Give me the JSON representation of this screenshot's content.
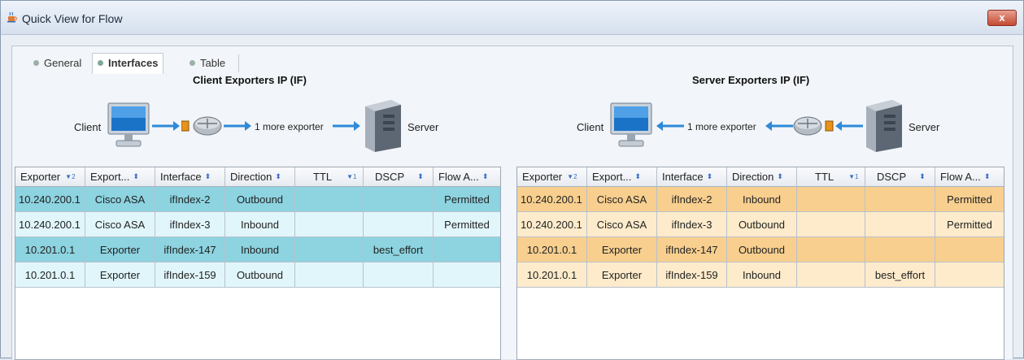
{
  "window": {
    "title": "Quick View for Flow",
    "close_label": "x"
  },
  "tabs": [
    {
      "label": "General",
      "active": false
    },
    {
      "label": "Interfaces",
      "active": true
    },
    {
      "label": "Table",
      "active": false
    }
  ],
  "client_section": {
    "title": "Client Exporters IP (IF)",
    "client_label": "Client",
    "server_label": "Server",
    "exporter_note": "1 more exporter"
  },
  "server_section": {
    "title": "Server Exporters IP (IF)",
    "client_label": "Client",
    "server_label": "Server",
    "exporter_note": "1 more exporter"
  },
  "columns": [
    {
      "label": "Exporter",
      "sort": "desc",
      "rank": "2"
    },
    {
      "label": "Export...",
      "sort": "both",
      "rank": ""
    },
    {
      "label": "Interface",
      "sort": "both",
      "rank": ""
    },
    {
      "label": "Direction",
      "sort": "both",
      "rank": ""
    },
    {
      "label": "TTL",
      "sort": "desc",
      "rank": "1"
    },
    {
      "label": "DSCP",
      "sort": "both",
      "rank": ""
    },
    {
      "label": "Flow A...",
      "sort": "both",
      "rank": ""
    }
  ],
  "client_rows": [
    [
      "10.240.200.1",
      "Cisco ASA",
      "ifIndex-2",
      "Outbound",
      "",
      "",
      "Permitted"
    ],
    [
      "10.240.200.1",
      "Cisco ASA",
      "ifIndex-3",
      "Inbound",
      "",
      "",
      "Permitted"
    ],
    [
      "10.201.0.1",
      "Exporter",
      "ifIndex-147",
      "Inbound",
      "",
      "best_effort",
      ""
    ],
    [
      "10.201.0.1",
      "Exporter",
      "ifIndex-159",
      "Outbound",
      "",
      "",
      ""
    ]
  ],
  "server_rows": [
    [
      "10.240.200.1",
      "Cisco ASA",
      "ifIndex-2",
      "Inbound",
      "",
      "",
      "Permitted"
    ],
    [
      "10.240.200.1",
      "Cisco ASA",
      "ifIndex-3",
      "Outbound",
      "",
      "",
      "Permitted"
    ],
    [
      "10.201.0.1",
      "Exporter",
      "ifIndex-147",
      "Outbound",
      "",
      "",
      ""
    ],
    [
      "10.201.0.1",
      "Exporter",
      "ifIndex-159",
      "Inbound",
      "",
      "best_effort",
      ""
    ]
  ],
  "icons": {
    "app": "java-cup-icon",
    "client": "monitor-icon",
    "server": "server-tower-icon",
    "router": "router-icon",
    "arrow": "arrow-icon"
  },
  "colors": {
    "client_selected": "#8dd3e0",
    "client_plain": "#e1f6fa",
    "server_selected": "#f8cf8f",
    "server_plain": "#fdebcb",
    "arrow": "#2f8ad8",
    "close": "#c44a33"
  }
}
